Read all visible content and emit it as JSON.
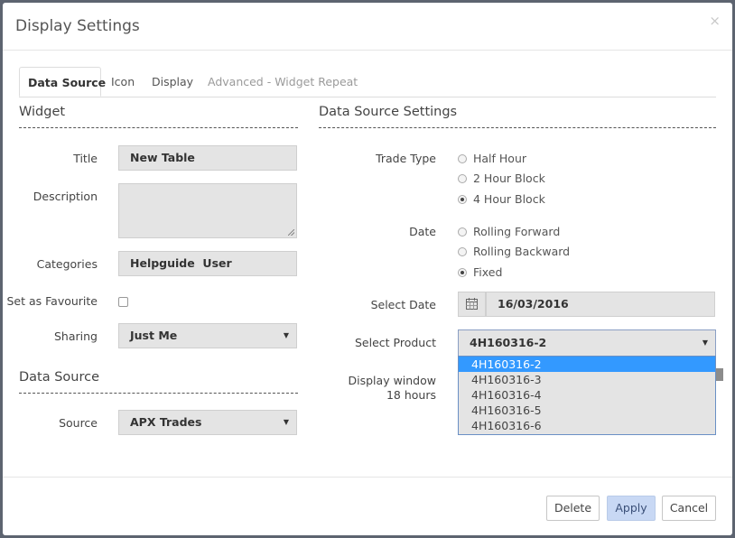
{
  "modal": {
    "title": "Display Settings",
    "close": "×"
  },
  "tabs": [
    {
      "label": "Data Source"
    },
    {
      "label": "Icon"
    },
    {
      "label": "Display"
    },
    {
      "label": "Advanced - Widget Repeat"
    }
  ],
  "widget": {
    "section_title": "Widget",
    "title_label": "Title",
    "title_value": "New Table",
    "description_label": "Description",
    "description_value": "",
    "categories_label": "Categories",
    "categories_value": "Helpguide  User",
    "favourite_label": "Set as Favourite",
    "sharing_label": "Sharing",
    "sharing_value": "Just Me"
  },
  "data_source": {
    "section_title": "Data Source",
    "source_label": "Source",
    "source_value": "APX Trades"
  },
  "settings": {
    "section_title": "Data Source Settings",
    "trade_type_label": "Trade Type",
    "trade_types": [
      "Half Hour",
      "2 Hour Block",
      "4 Hour Block"
    ],
    "date_label": "Date",
    "dates": [
      "Rolling Forward",
      "Rolling Backward",
      "Fixed"
    ],
    "select_date_label": "Select Date",
    "select_date_value": "16/03/2016",
    "select_product_label": "Select Product",
    "select_product_value": "4H160316-2",
    "product_options": [
      "4H160316-2",
      "4H160316-3",
      "4H160316-4",
      "4H160316-5",
      "4H160316-6"
    ],
    "display_window_label": "Display window",
    "display_window_value": "18 hours"
  },
  "footer": {
    "delete": "Delete",
    "apply": "Apply",
    "cancel": "Cancel"
  },
  "icons": {
    "close": "close-icon",
    "calendar": "calendar-icon",
    "caret": "caret-down-icon"
  },
  "colors": {
    "primary_button": "#c8d8f4",
    "selected_option": "#3399ff"
  }
}
